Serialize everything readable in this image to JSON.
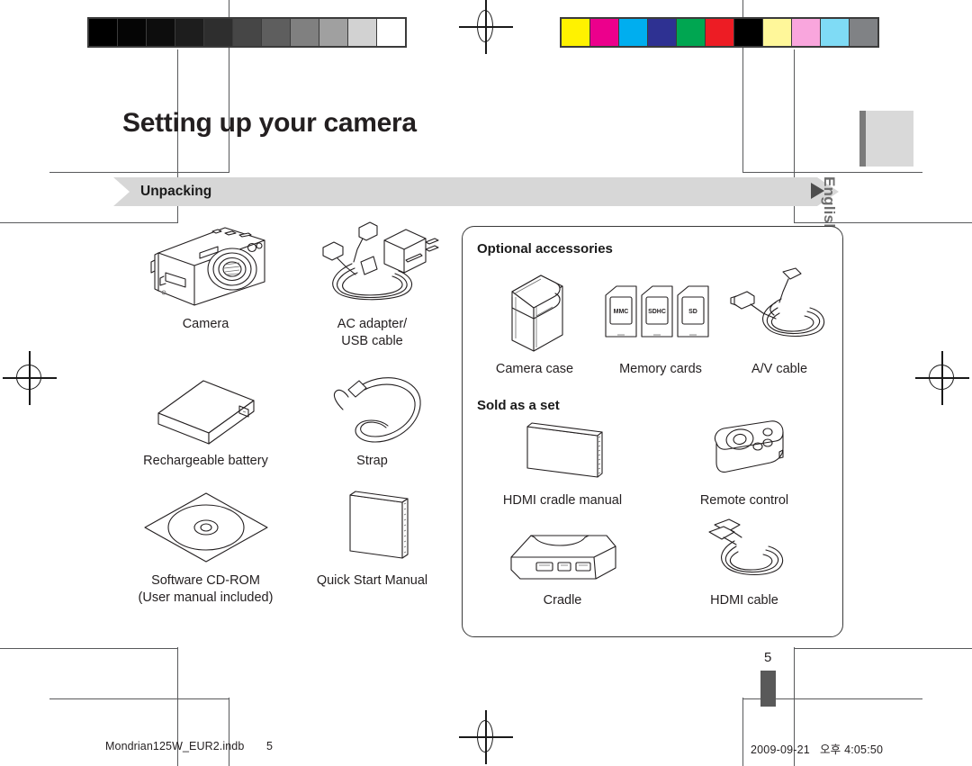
{
  "document": {
    "page_title": "Setting up your camera",
    "section_label": "Unpacking",
    "language_tab": "English",
    "page_number": "5"
  },
  "footer": {
    "filename": "Mondrian125W_EUR2.indb",
    "page": "5",
    "date": "2009-09-21",
    "meridiem": "오후",
    "time": "4:05:50"
  },
  "unpacking": {
    "items": [
      {
        "icon": "camera-icon",
        "caption": "Camera"
      },
      {
        "icon": "ac-adapter-usb-cable-icon",
        "caption": "AC adapter/\nUSB cable"
      },
      {
        "icon": "battery-icon",
        "caption": "Rechargeable battery"
      },
      {
        "icon": "strap-icon",
        "caption": "Strap"
      },
      {
        "icon": "cd-rom-icon",
        "caption": "Software CD-ROM\n(User manual included)"
      },
      {
        "icon": "manual-icon",
        "caption": "Quick Start Manual"
      }
    ]
  },
  "optional_accessories": {
    "heading": "Optional accessories",
    "items": [
      {
        "icon": "camera-case-icon",
        "caption": "Camera case"
      },
      {
        "icon": "memory-cards-icon",
        "caption": "Memory cards",
        "card_labels": [
          "MMC",
          "SDHC",
          "SD"
        ]
      },
      {
        "icon": "av-cable-icon",
        "caption": "A/V cable"
      }
    ]
  },
  "sold_as_a_set": {
    "heading": "Sold as a set",
    "items": [
      {
        "icon": "hdmi-cradle-manual-icon",
        "caption": "HDMI cradle manual"
      },
      {
        "icon": "remote-control-icon",
        "caption": "Remote control"
      },
      {
        "icon": "cradle-icon",
        "caption": "Cradle"
      },
      {
        "icon": "hdmi-cable-icon",
        "caption": "HDMI cable"
      }
    ]
  },
  "calibration": {
    "grayscale_swatches": [
      "#000000",
      "#050505",
      "#0d0d0d",
      "#1d1d1d",
      "#2e2e2e",
      "#464646",
      "#5e5e5e",
      "#808080",
      "#a0a0a0",
      "#d2d2d2",
      "#ffffff"
    ],
    "color_swatches": [
      "#fff200",
      "#ec008c",
      "#00aeef",
      "#2e3192",
      "#00a651",
      "#ed1c24",
      "#000000",
      "#fff79a",
      "#f9a6dd",
      "#7fdbf5",
      "#808285"
    ]
  }
}
